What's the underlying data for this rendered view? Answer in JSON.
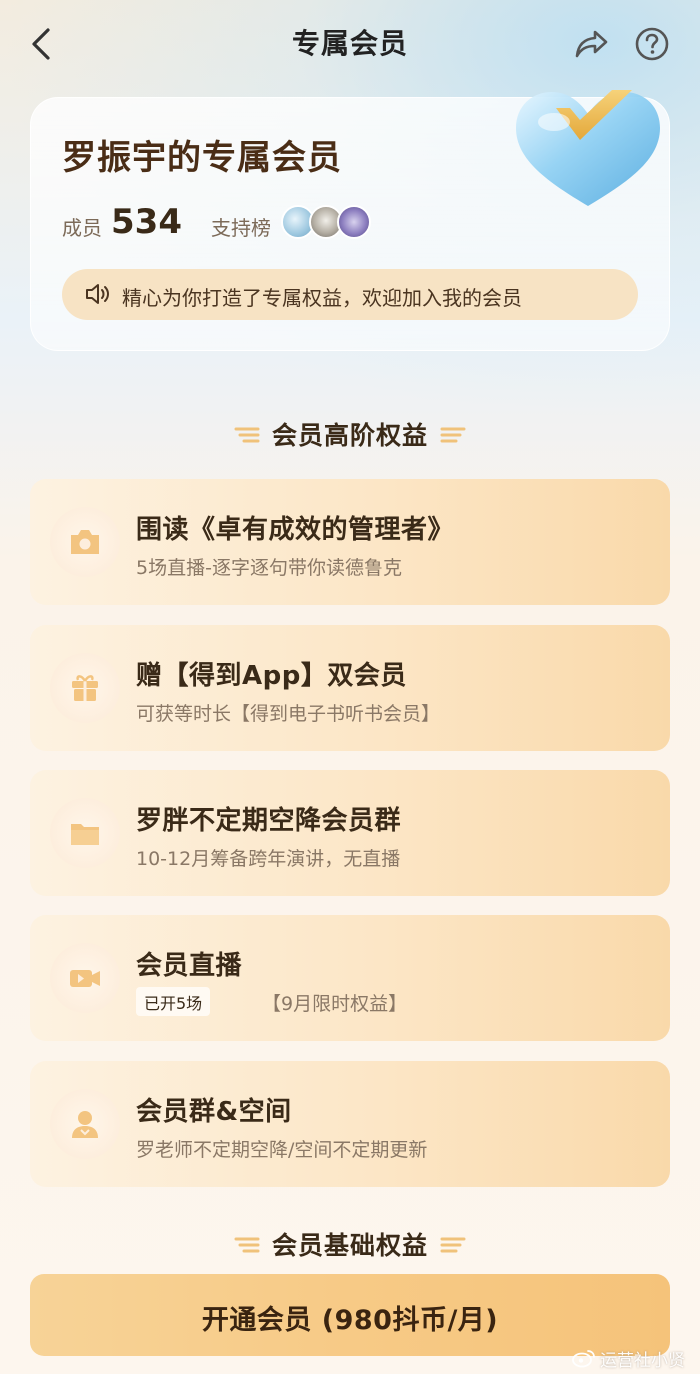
{
  "nav": {
    "title": "专属会员",
    "icons": [
      "chevron-left-icon",
      "share-icon",
      "help-icon"
    ]
  },
  "hero": {
    "title": "罗振宇的专属会员",
    "members_label": "成员",
    "members_count": "534",
    "support_label": "支持榜",
    "notice": "精心为你打造了专属权益，欢迎加入我的会员"
  },
  "sections": {
    "advanced": "会员高阶权益",
    "basic": "会员基础权益"
  },
  "benefits": [
    {
      "icon": "camera-icon",
      "title": "围读《卓有成效的管理者》",
      "subtitle": "5场直播-逐字逐句带你读德鲁克"
    },
    {
      "icon": "gift-icon",
      "title": "赠【得到App】双会员",
      "subtitle": "可获等时长【得到电子书听书会员】"
    },
    {
      "icon": "folder-icon",
      "title": "罗胖不定期空降会员群",
      "subtitle": "10-12月筹备跨年演讲，无直播"
    },
    {
      "icon": "video-icon",
      "title": "会员直播",
      "tag": "已开5场",
      "subtitle": "【9月限时权益】"
    },
    {
      "icon": "user-icon",
      "title": "会员群&空间",
      "subtitle": "罗老师不定期空降/空间不定期更新"
    }
  ],
  "cta": {
    "label": "开通会员 (980抖币/月)"
  },
  "watermark": {
    "text": "运营社小贤"
  },
  "colors": {
    "accent": "#f7ca86",
    "card": "#fce6c6",
    "text": "#3a2a18"
  }
}
